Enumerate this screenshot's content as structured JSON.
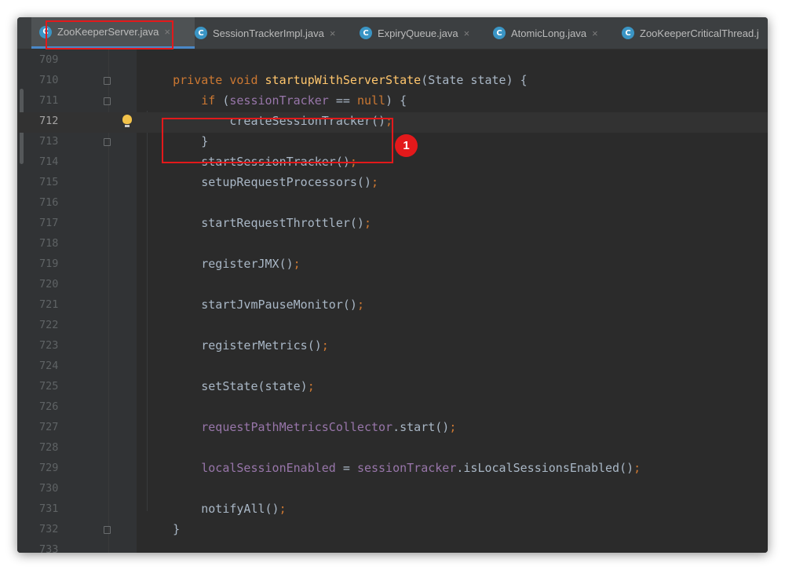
{
  "tabs": [
    {
      "label": "ZooKeeperServer.java",
      "icon": "class-icon",
      "active": true
    },
    {
      "label": "SessionTrackerImpl.java",
      "icon": "class-icon",
      "active": false
    },
    {
      "label": "ExpiryQueue.java",
      "icon": "class-icon",
      "active": false
    },
    {
      "label": "AtomicLong.java",
      "icon": "class-icon",
      "active": false
    },
    {
      "label": "ZooKeeperCriticalThread.j",
      "icon": "class-icon",
      "active": false
    }
  ],
  "tab_icon_letter": "C",
  "tab_close_glyph": "×",
  "annotation": {
    "badge": "1",
    "accent_color": "#e3191b"
  },
  "editor": {
    "current_line": "712",
    "lines": [
      {
        "num": "709",
        "code": []
      },
      {
        "num": "710",
        "code": [
          {
            "t": "    ",
            "c": ""
          },
          {
            "t": "private ",
            "c": "kw"
          },
          {
            "t": "void ",
            "c": "kw"
          },
          {
            "t": "startupWithServerState",
            "c": "fn"
          },
          {
            "t": "(State state) {",
            "c": ""
          }
        ]
      },
      {
        "num": "711",
        "code": [
          {
            "t": "        ",
            "c": ""
          },
          {
            "t": "if ",
            "c": "kw"
          },
          {
            "t": "(",
            "c": ""
          },
          {
            "t": "sessionTracker",
            "c": "fld"
          },
          {
            "t": " == ",
            "c": ""
          },
          {
            "t": "null",
            "c": "kw"
          },
          {
            "t": ") {",
            "c": ""
          }
        ]
      },
      {
        "num": "712",
        "code": [
          {
            "t": "            createSessionTracker()",
            "c": ""
          },
          {
            "t": ";",
            "c": "sc"
          }
        ]
      },
      {
        "num": "713",
        "code": [
          {
            "t": "        }",
            "c": ""
          }
        ]
      },
      {
        "num": "714",
        "code": [
          {
            "t": "        startSessionTracker()",
            "c": ""
          },
          {
            "t": ";",
            "c": "sc"
          }
        ]
      },
      {
        "num": "715",
        "code": [
          {
            "t": "        setupRequestProcessors()",
            "c": ""
          },
          {
            "t": ";",
            "c": "sc"
          }
        ]
      },
      {
        "num": "716",
        "code": []
      },
      {
        "num": "717",
        "code": [
          {
            "t": "        startRequestThrottler()",
            "c": ""
          },
          {
            "t": ";",
            "c": "sc"
          }
        ]
      },
      {
        "num": "718",
        "code": []
      },
      {
        "num": "719",
        "code": [
          {
            "t": "        registerJMX()",
            "c": ""
          },
          {
            "t": ";",
            "c": "sc"
          }
        ]
      },
      {
        "num": "720",
        "code": []
      },
      {
        "num": "721",
        "code": [
          {
            "t": "        startJvmPauseMonitor()",
            "c": ""
          },
          {
            "t": ";",
            "c": "sc"
          }
        ]
      },
      {
        "num": "722",
        "code": []
      },
      {
        "num": "723",
        "code": [
          {
            "t": "        registerMetrics()",
            "c": ""
          },
          {
            "t": ";",
            "c": "sc"
          }
        ]
      },
      {
        "num": "724",
        "code": []
      },
      {
        "num": "725",
        "code": [
          {
            "t": "        setState(state)",
            "c": ""
          },
          {
            "t": ";",
            "c": "sc"
          }
        ]
      },
      {
        "num": "726",
        "code": []
      },
      {
        "num": "727",
        "code": [
          {
            "t": "        ",
            "c": ""
          },
          {
            "t": "requestPathMetricsCollector",
            "c": "fld"
          },
          {
            "t": ".start()",
            "c": ""
          },
          {
            "t": ";",
            "c": "sc"
          }
        ]
      },
      {
        "num": "728",
        "code": []
      },
      {
        "num": "729",
        "code": [
          {
            "t": "        ",
            "c": ""
          },
          {
            "t": "localSessionEnabled",
            "c": "fld"
          },
          {
            "t": " = ",
            "c": ""
          },
          {
            "t": "sessionTracker",
            "c": "fld"
          },
          {
            "t": ".isLocalSessionsEnabled()",
            "c": ""
          },
          {
            "t": ";",
            "c": "sc"
          }
        ]
      },
      {
        "num": "730",
        "code": []
      },
      {
        "num": "731",
        "code": [
          {
            "t": "        notifyAll()",
            "c": ""
          },
          {
            "t": ";",
            "c": "sc"
          }
        ]
      },
      {
        "num": "732",
        "code": [
          {
            "t": "    }",
            "c": ""
          }
        ]
      },
      {
        "num": "733",
        "code": []
      }
    ]
  },
  "colors": {
    "background": "#2b2b2b",
    "keyword": "#cc7832",
    "method_decl": "#ffc66d",
    "field": "#9876aa",
    "default_text": "#a9b7c6",
    "tab_icon": "#3a95c5"
  }
}
